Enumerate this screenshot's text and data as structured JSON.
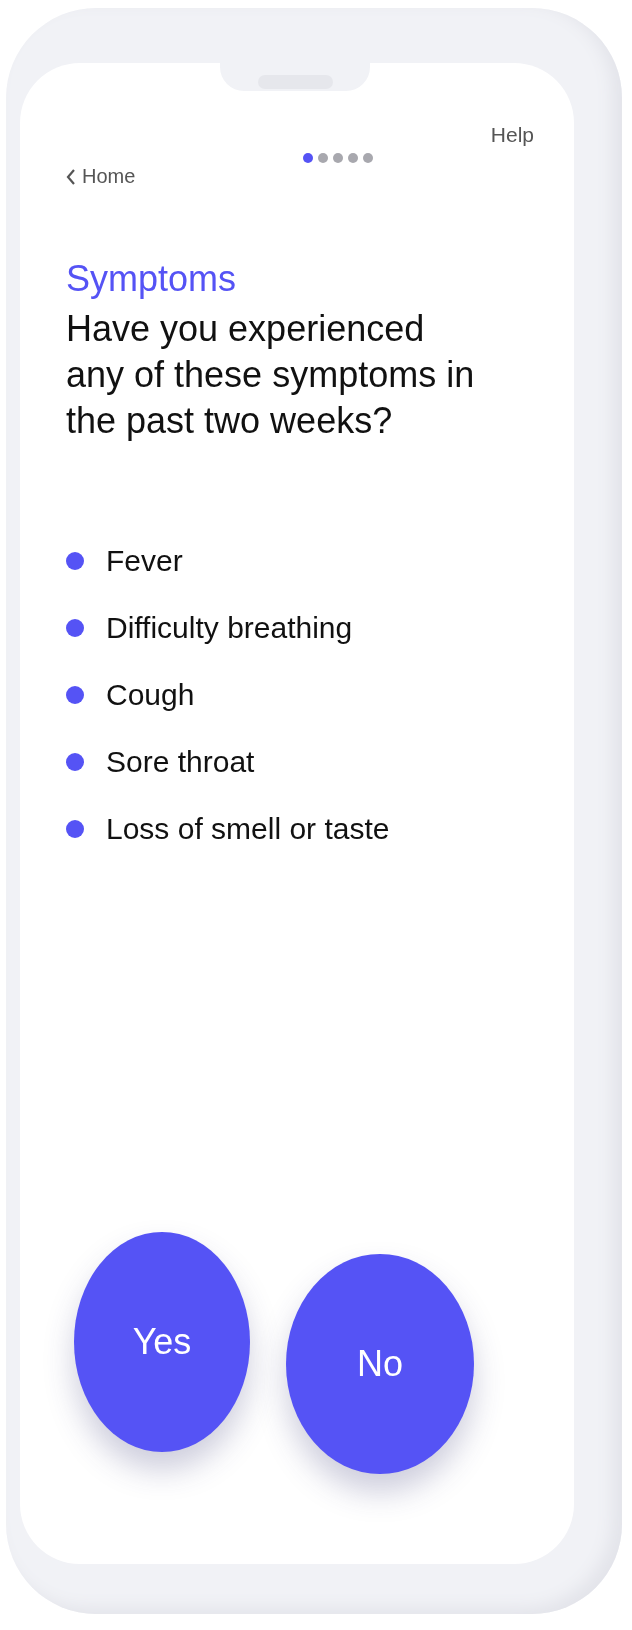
{
  "nav": {
    "back": "Home",
    "help": "Help"
  },
  "steps": [
    {
      "selected": true
    },
    {
      "selected": false
    },
    {
      "selected": false
    },
    {
      "selected": false
    },
    {
      "selected": false
    }
  ],
  "section": "Symptoms",
  "question": "Have you experienced any of these symptoms in the past two weeks?",
  "symptoms": [
    {
      "label": "Fever",
      "color": "#5553f5"
    },
    {
      "label": "Difficulty breathing",
      "color": "#5553f5"
    },
    {
      "label": "Cough",
      "color": "#5553f5"
    },
    {
      "label": "Sore throat",
      "color": "#5553f5"
    },
    {
      "label": "Loss of smell or taste",
      "color": "#5553f5"
    }
  ],
  "answers": [
    "Yes",
    "No"
  ]
}
